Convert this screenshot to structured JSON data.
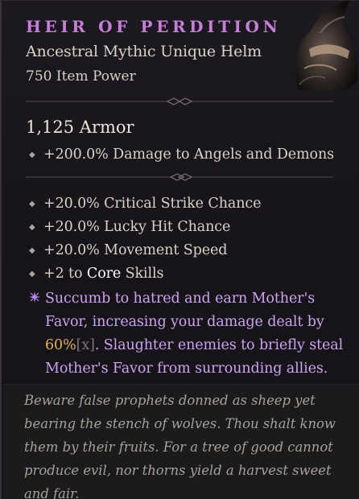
{
  "item": {
    "name": "HEIR OF PERDITION",
    "type": "Ancestral Mythic Unique Helm",
    "item_power": "750 Item Power",
    "icon": "helm-icon",
    "name_color": "#c77ed9",
    "unique_color": "#cba3f2",
    "value_color": "#e3b062"
  },
  "stats": {
    "armor": "1,125 Armor",
    "implicit": "+200.0% Damage to Angels and Demons"
  },
  "affixes": [
    {
      "text": "+20.0% Critical Strike Chance"
    },
    {
      "text": "+20.0% Lucky Hit Chance"
    },
    {
      "text": "+20.0% Movement Speed"
    },
    {
      "prefix": "+2 to ",
      "highlight": "Core",
      "suffix": " Skills"
    }
  ],
  "unique_power": {
    "text_before": "Succumb to hatred and earn Mother's Favor, increasing your damage dealt by ",
    "value": "60%",
    "bracket": "[x]",
    "text_after": ". Slaughter enemies to briefly steal Mother's Favor from surrounding allies."
  },
  "flavor_text": "Beware false prophets donned as sheep yet bearing the stench of wolves. Thou shalt know them by their fruits. For a tree of good cannot produce evil, nor thorns yield a harvest sweet and fair."
}
